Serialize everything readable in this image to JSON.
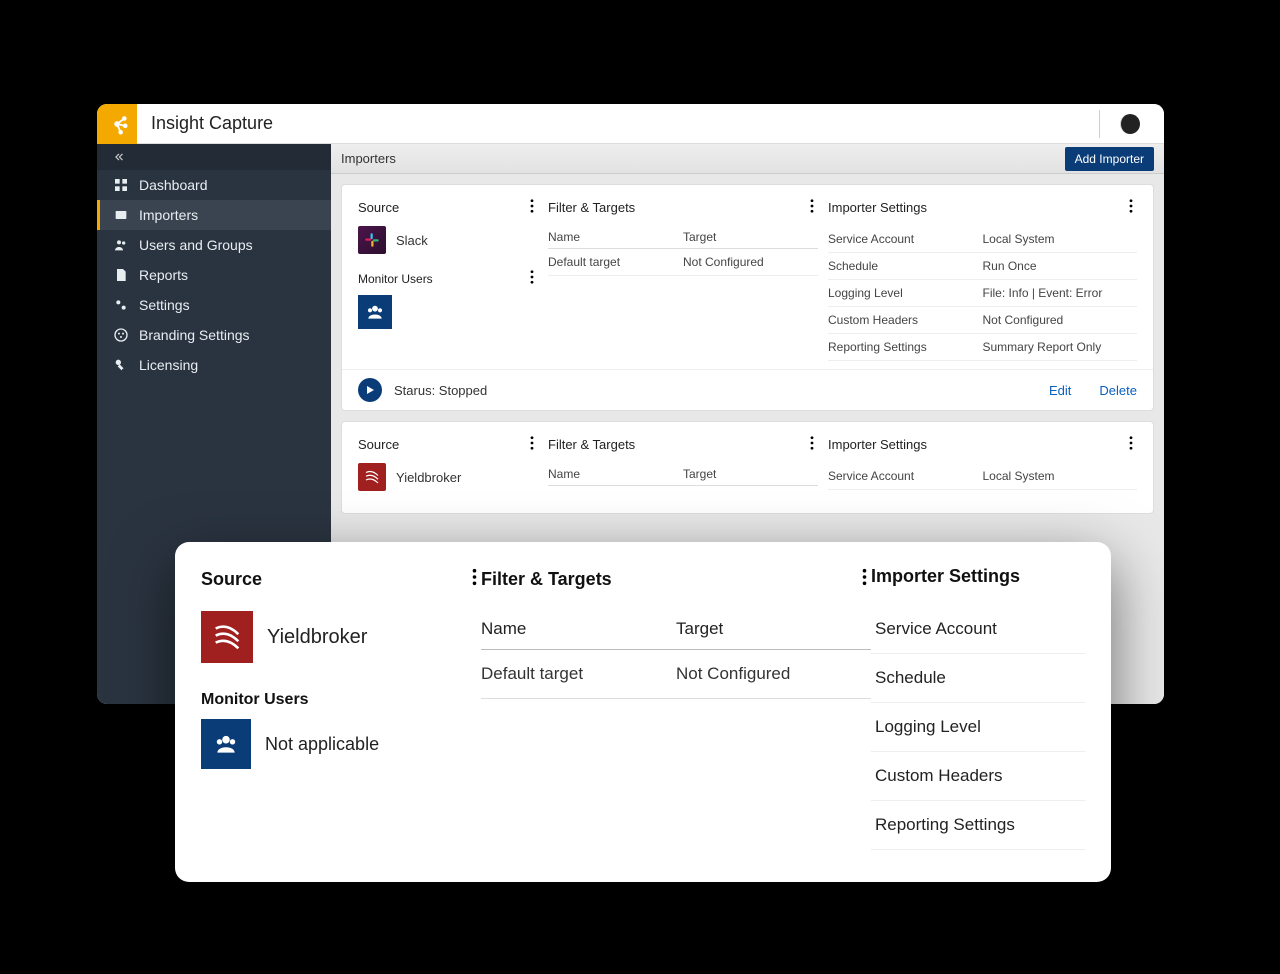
{
  "appTitle": "Insight Capture",
  "sidebar": {
    "items": [
      {
        "label": "Dashboard"
      },
      {
        "label": "Importers"
      },
      {
        "label": "Users and Groups"
      },
      {
        "label": "Reports"
      },
      {
        "label": "Settings"
      },
      {
        "label": "Branding Settings"
      },
      {
        "label": "Licensing"
      }
    ]
  },
  "pageHeader": {
    "title": "Importers",
    "addBtn": "Add Importer"
  },
  "labels": {
    "source": "Source",
    "filterTargets": "Filter & Targets",
    "importerSettings": "Importer Settings",
    "monitorUsers": "Monitor Users",
    "name": "Name",
    "target": "Target"
  },
  "settingsKeys": {
    "serviceAccount": "Service Account",
    "schedule": "Schedule",
    "loggingLevel": "Logging Level",
    "customHeaders": "Custom Headers",
    "reportingSettings": "Reporting Settings"
  },
  "cards": [
    {
      "sourceName": "Slack",
      "target": {
        "name": "Default target",
        "value": "Not Configured"
      },
      "settings": {
        "serviceAccount": "Local System",
        "schedule": "Run Once",
        "loggingLevel": "File: Info | Event: Error",
        "customHeaders": "Not Configured",
        "reportingSettings": "Summary Report Only"
      },
      "status": "Starus: Stopped",
      "editLabel": "Edit",
      "deleteLabel": "Delete"
    },
    {
      "sourceName": "Yieldbroker",
      "target": {
        "name": "Name",
        "value": "Target"
      },
      "settings": {
        "serviceAccount": "Local System"
      }
    }
  ],
  "overlay": {
    "sourceName": "Yieldbroker",
    "monitorUsersValue": "Not applicable",
    "target": {
      "name": "Default target",
      "value": "Not Configured"
    }
  }
}
